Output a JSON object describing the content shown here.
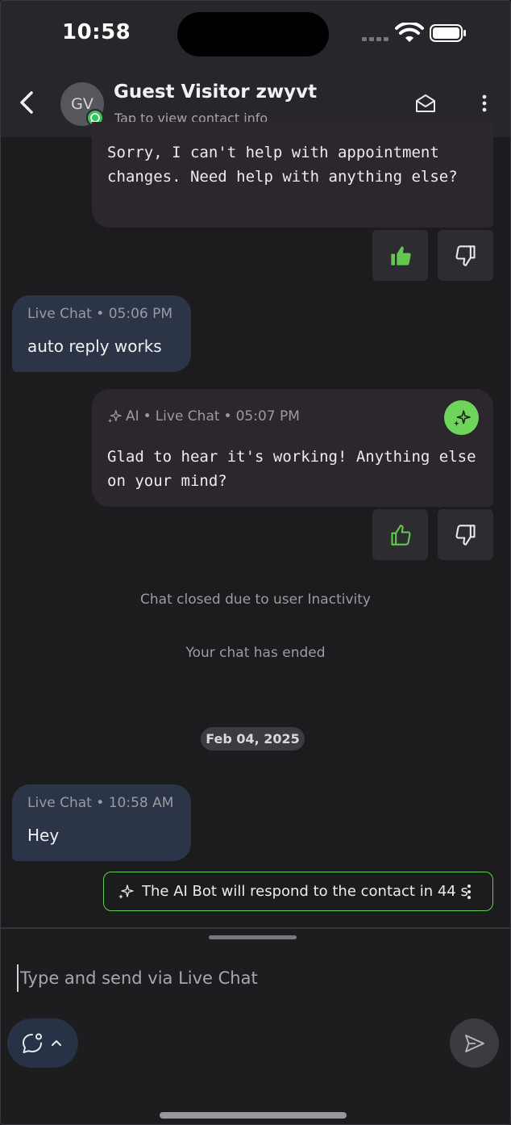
{
  "status_bar": {
    "time": "10:58"
  },
  "header": {
    "avatar_initials": "GV",
    "contact_name": "Guest Visitor zwyvt",
    "contact_subtitle": "Tap to view contact info"
  },
  "messages": [
    {
      "id": "m1",
      "direction": "outgoing",
      "text": "Sorry, I can't help with appointment changes. Need help with anything else?",
      "feedback": {
        "liked": true,
        "disliked": false
      }
    },
    {
      "id": "m2",
      "direction": "incoming",
      "channel": "Live Chat",
      "time": "05:06 PM",
      "text": "auto reply works"
    },
    {
      "id": "m3",
      "direction": "outgoing",
      "sender": "AI",
      "channel": "Live Chat",
      "time": "05:07 PM",
      "text": "Glad to hear it's working! Anything else on your mind?",
      "feedback": {
        "liked": false,
        "disliked": false
      }
    },
    {
      "id": "m4",
      "direction": "incoming",
      "channel": "Live Chat",
      "time": "10:58 AM",
      "text": "Hey"
    }
  ],
  "system": {
    "chat_closed": "Chat closed due to user Inactivity",
    "chat_ended": "Your chat has ended"
  },
  "date_separator": "Feb 04, 2025",
  "ai_banner": {
    "text": "The AI Bot will respond to the contact in 44 s"
  },
  "composer": {
    "placeholder": "Type and send via Live Chat"
  },
  "colors": {
    "accent_green": "#66cc52",
    "incoming_bubble": "#2b3547",
    "outgoing_bubble": "#2b272d",
    "header_bg": "#27272b"
  }
}
